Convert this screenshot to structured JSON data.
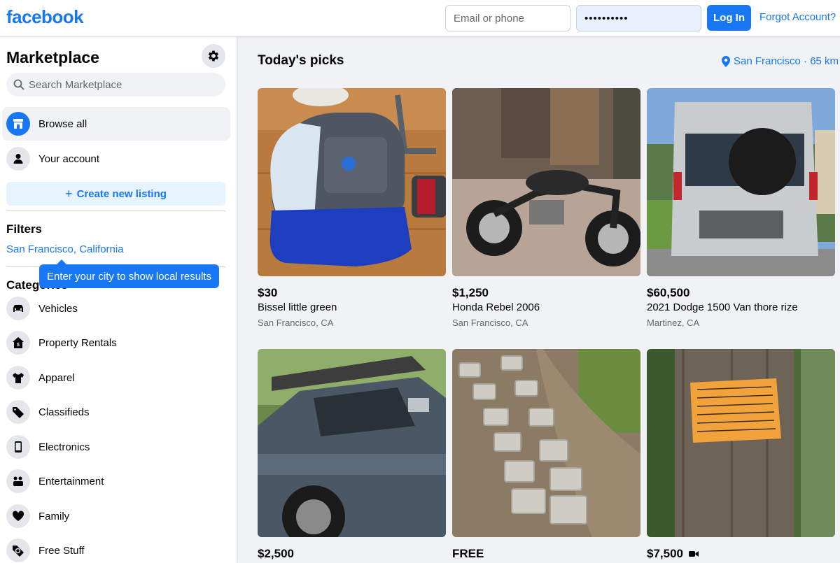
{
  "header": {
    "logo": "facebook",
    "email_placeholder": "Email or phone",
    "password_mask": "••••••••••",
    "login_label": "Log In",
    "forgot_label": "Forgot Account?"
  },
  "sidebar": {
    "title": "Marketplace",
    "search_placeholder": "Search Marketplace",
    "nav": [
      {
        "label": "Browse all",
        "icon": "storefront-icon"
      },
      {
        "label": "Your account",
        "icon": "person-icon"
      }
    ],
    "create_listing": "Create new listing",
    "filters_heading": "Filters",
    "location": "San Francisco, California",
    "tooltip": "Enter your city to show local results",
    "categories_heading": "Categories",
    "categories": [
      {
        "label": "Vehicles",
        "icon": "car-icon"
      },
      {
        "label": "Property Rentals",
        "icon": "house-icon"
      },
      {
        "label": "Apparel",
        "icon": "shirt-icon"
      },
      {
        "label": "Classifieds",
        "icon": "tag-icon"
      },
      {
        "label": "Electronics",
        "icon": "phone-icon"
      },
      {
        "label": "Entertainment",
        "icon": "people-icon"
      },
      {
        "label": "Family",
        "icon": "heart-icon"
      },
      {
        "label": "Free Stuff",
        "icon": "free-tag-icon"
      }
    ]
  },
  "main": {
    "title": "Today's picks",
    "location_label": "San Francisco · 65 km",
    "listings": [
      {
        "price": "$30",
        "title": "Bissel little green",
        "location": "San Francisco, CA"
      },
      {
        "price": "$1,250",
        "title": "Honda Rebel 2006",
        "location": "San Francisco, CA"
      },
      {
        "price": "$60,500",
        "title": "2021 Dodge 1500 Van thore rize",
        "location": "Martinez, CA"
      },
      {
        "price": "$2,500",
        "title": "",
        "location": ""
      },
      {
        "price": "FREE",
        "title": "",
        "location": ""
      },
      {
        "price": "$7,500",
        "title": "",
        "location": ""
      }
    ]
  },
  "colors": {
    "brand": "#1877f2",
    "background": "#f0f2f5"
  }
}
